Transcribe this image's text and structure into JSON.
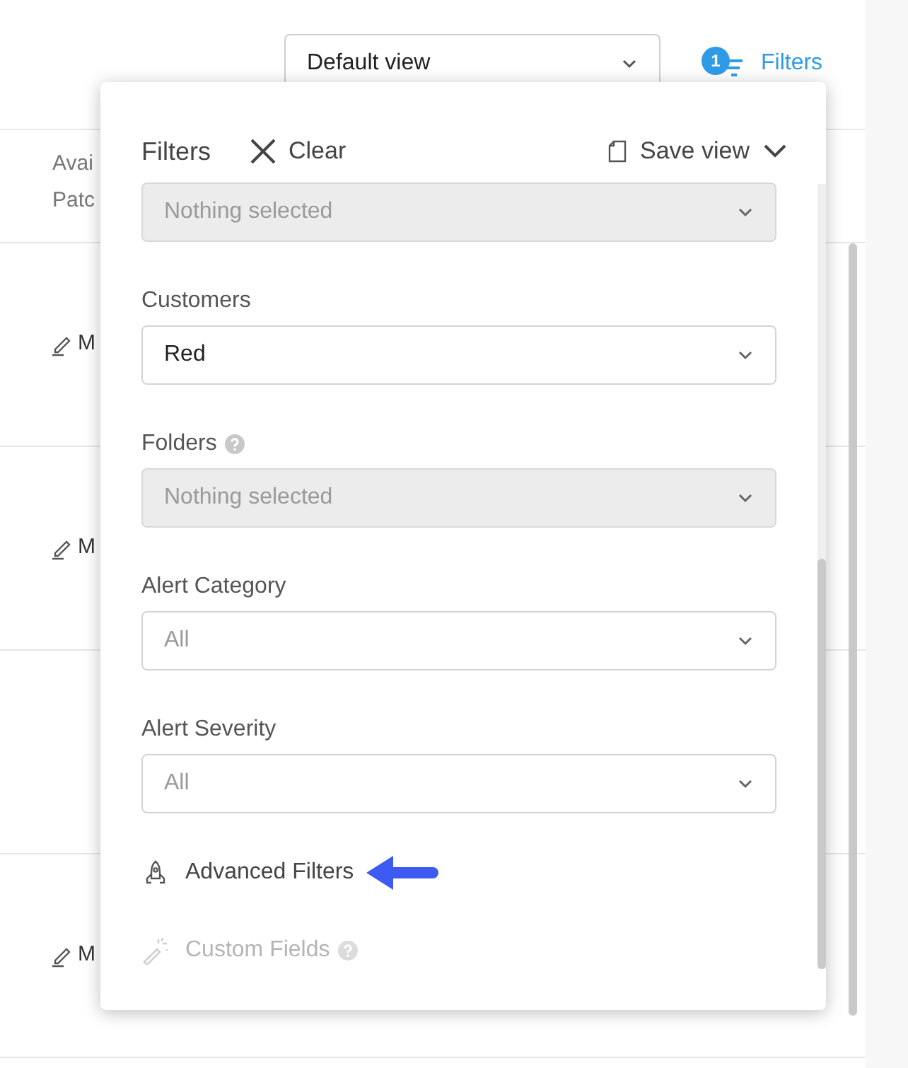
{
  "toolbar": {
    "view_select": {
      "value": "Default view"
    },
    "filters_button": {
      "label": "Filters",
      "badge": "1"
    }
  },
  "table": {
    "header": [
      "Avai",
      "Patc"
    ],
    "rows": [
      {
        "kind": "edit",
        "column_1": "M"
      },
      {
        "kind": "edit",
        "column_1": "M"
      },
      {
        "kind": "blank"
      },
      {
        "kind": "edit",
        "column_1": "M"
      }
    ]
  },
  "filters_panel": {
    "title": "Filters",
    "clear": "Clear",
    "save_view": "Save view",
    "fields": [
      {
        "placeholder": "Nothing selected",
        "disabled": true
      },
      {
        "label": "Customers",
        "value": "Red",
        "disabled": false
      },
      {
        "label": "Folders",
        "placeholder": "Nothing selected",
        "disabled": true,
        "help": true
      },
      {
        "label": "Alert Category",
        "placeholder": "All",
        "disabled": false
      },
      {
        "label": "Alert Severity",
        "placeholder": "All",
        "disabled": false
      }
    ],
    "links": [
      {
        "kind": "rocket",
        "label": "Advanced Filters",
        "disabled": false
      },
      {
        "kind": "wand",
        "label": "Custom Fields",
        "disabled": true,
        "help": true
      }
    ]
  }
}
